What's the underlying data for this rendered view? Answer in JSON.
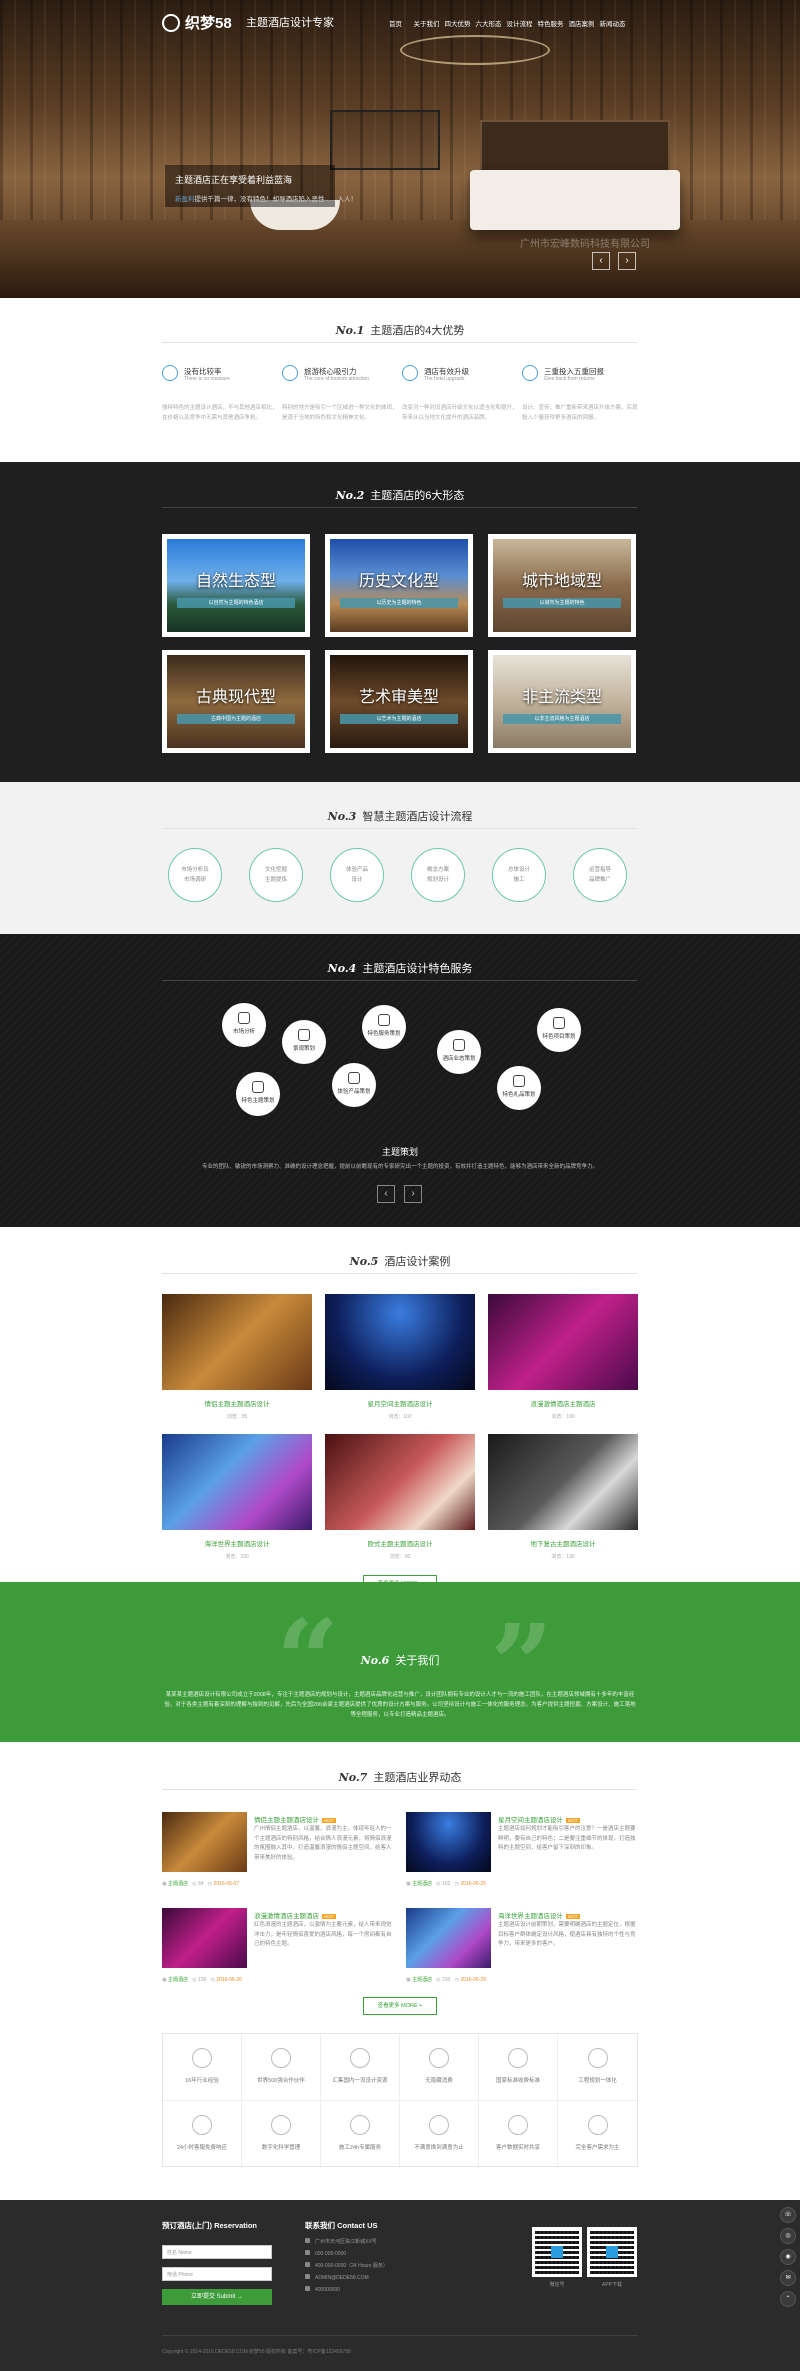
{
  "header": {
    "logo": "织梦58",
    "slogan": "主题酒店设计专家",
    "menu": [
      "首页",
      "关于我们",
      "四大优势",
      "六大形态",
      "设计流程",
      "特色服务",
      "酒店案例",
      "新闻动态"
    ]
  },
  "hero": {
    "title": "主题酒店正在享受着利益蓝海",
    "subtitle_prefix": "新盈利",
    "subtitle": "提供千篇一律，没有特色！却导酒店陷入恶性……入人！",
    "watermark": "广州市宏峰数码科技有限公司",
    "prev": "‹",
    "next": "›"
  },
  "s1": {
    "no": "No.1",
    "title": "主题酒店的4大优势",
    "items": [
      {
        "h": "没有比较率",
        "s": "There is no measure",
        "d": "独特特色的主题设计酒店，不与其他酒店相比，在价格以及竞争中无需与其他酒店争抢。"
      },
      {
        "h": "旅游核心吸引力",
        "s": "The core of tourism attraction",
        "d": "特别的地方是吸引一个区域进一种文化的体现，是源于当地的特色和文化精神文化。"
      },
      {
        "h": "酒店有效升级",
        "s": "The hotel upgrade",
        "d": "改变对一种对旧酒店升级文化以适当化和提升，带来从以当地文化提升的酒店品牌。"
      },
      {
        "h": "三重投入五重回报",
        "s": "Give back from returns",
        "d": "设计、宣传，推广重新带来酒店升级方案，实现投入少量获得更多酒店的回报。"
      }
    ]
  },
  "s2": {
    "no": "No.2",
    "title": "主题酒店的6大形态",
    "cards": [
      {
        "label": "自然生态型",
        "strip": "以自然为主题的特色酒店"
      },
      {
        "label": "历史文化型",
        "strip": "以历史为主题的特色"
      },
      {
        "label": "城市地域型",
        "strip": "以城市为主题的特色"
      },
      {
        "label": "古典现代型",
        "strip": "古典中国为主题的酒店"
      },
      {
        "label": "艺术审美型",
        "strip": "以艺术为主题的酒店"
      },
      {
        "label": "非主流类型",
        "strip": "以非主流风格为主题酒店"
      }
    ]
  },
  "s3": {
    "no": "No.3",
    "title": "智慧主题酒店设计流程",
    "steps": [
      {
        "a": "市场分析及",
        "b": "市场调研"
      },
      {
        "a": "文化挖掘",
        "b": "主题提炼"
      },
      {
        "a": "体验产品",
        "b": "设计"
      },
      {
        "a": "概念方案",
        "b": "规划设计"
      },
      {
        "a": "总体设计",
        "b": "施工"
      },
      {
        "a": "运营指导",
        "b": "品牌推广"
      }
    ]
  },
  "s4": {
    "no": "No.4",
    "title": "主题酒店设计特色服务",
    "bubbles": [
      "市场分析",
      "景观策划",
      "特色服务策划",
      "酒店业态策划",
      "特色项目策划",
      "特色主题策划",
      "体验产品策划",
      "特色礼品策划"
    ],
    "heading": "主题策划",
    "desc": "专业的团队、敏锐的市场洞察力、准确的设计理念把握，提前以前瞻现有的专家研究出一个主题的投资，有效并打造主题特色，能够为酒店带来全新的品牌竞争力。",
    "prev": "‹",
    "next": "›"
  },
  "s5": {
    "no": "No.5",
    "title": "酒店设计案例",
    "cases": [
      {
        "name": "情侣主题主题酒店设计",
        "count": "浏览：85"
      },
      {
        "name": "星月空间主题酒店设计",
        "count": "浏览：102"
      },
      {
        "name": "浪漫激情酒店主题酒店",
        "count": "浏览：199"
      },
      {
        "name": "海洋世界主题酒店设计",
        "count": "浏览：230"
      },
      {
        "name": "欧式主题主题酒店设计",
        "count": "浏览：90"
      },
      {
        "name": "地下复古主题酒店设计",
        "count": "浏览：130"
      }
    ],
    "more": "查看更多 MORE +"
  },
  "s6": {
    "no": "No.6",
    "title": "关于我们",
    "text": "某某某主题酒店设计有限公司成立于2008年，专注于主题酒店的规划与设计，主题酒店品牌化运营与推广，设计团队拥有专业的设计人才与一流的施工团队，在主题酒店领域拥有十多年的丰富经验，对于各类主题有着深刻的理解与独到的见解，先后为全国200余家主题酒店提供了优质的设计方案与服务。公司坚持设计与施工一体化的服务理念，为客户提供主题挖掘、方案设计、施工落地等全程服务，以专业打造精品主题酒店。"
  },
  "s7": {
    "no": "No.7",
    "title": "主题酒店业界动态",
    "news": [
      {
        "title": "情侣主题主题酒店设计",
        "tag": "HOT",
        "desc": "广州情侣主题酒店，以温馨、浪漫为主，体现年轻人的一个主题酒店的特别风格，结合情人浪漫元素，将情侣浪漫的氛围融入其中，打造温馨浪漫的情侣主题空间，给客人带来美好的体验。",
        "cat": "主题酒店",
        "views": "84",
        "date": "2016-06-07"
      },
      {
        "title": "星月空间主题酒店设计",
        "tag": "HOT",
        "desc": "主题酒店如何规划才能吸引客户的注意？一是酒店主题要鲜明，要有自己的特色；二是要注重细节的体现，打造独特的主题空间，给客户留下深刻的印象。",
        "cat": "主题酒店",
        "views": "102",
        "date": "2016-06-25"
      },
      {
        "title": "浪漫激情酒店主题酒店",
        "tag": "HOT",
        "desc": "红色浪漫的主题酒店，以激情为主要元素，给人带来视觉冲击力，是年轻情侣喜爱的酒店风格，每一个房间都有自己的特色主题。",
        "cat": "主题酒店",
        "views": "199",
        "date": "2016-06-26"
      },
      {
        "title": "海洋世界主题酒店设计",
        "tag": "HOT",
        "desc": "主题酒店设计前期策划，需要明确酒店的主题定位，根据目标客户群体确定设计风格，使酒店具有独特的个性与竞争力，带来更多的客户。",
        "cat": "主题酒店",
        "views": "230",
        "date": "2016-06-29"
      }
    ],
    "more": "查看更多 MORE +"
  },
  "features": [
    "16年行业经验",
    "世界500强合作伙伴",
    "汇集国内一流设计资源",
    "无隐藏消费",
    "国家标准收费标准",
    "工程规划一体化",
    "24小时客服免费响应",
    "数字化科学管理",
    "施工24h专属服务",
    "不满意换到满意为止",
    "客户数据实时共享",
    "完全客户需求为主"
  ],
  "footer": {
    "res_title": "预订酒店(上门) Reservation",
    "name_ph": "姓名 Name",
    "phone_ph": "电话 Phone",
    "submit": "立即提交 Submit →",
    "contact_title": "联系我们 Contact US",
    "contacts": [
      "广州市天河区珠江新城XX号",
      "000-000-0000",
      "400-000-0000（24 Hours 服务）",
      "ADMIN@DEDE58.COM",
      "400000000"
    ],
    "qr1": "微信号",
    "qr2": "APP下载",
    "copyright": "Copyright © 2014-2016 DEDE58.COM 织梦58 版权所有 备案号：粤ICP备123456789"
  },
  "colors": {
    "green": "#3d9b3a",
    "blue": "#4aa3df",
    "dark": "#1f1f1f"
  }
}
